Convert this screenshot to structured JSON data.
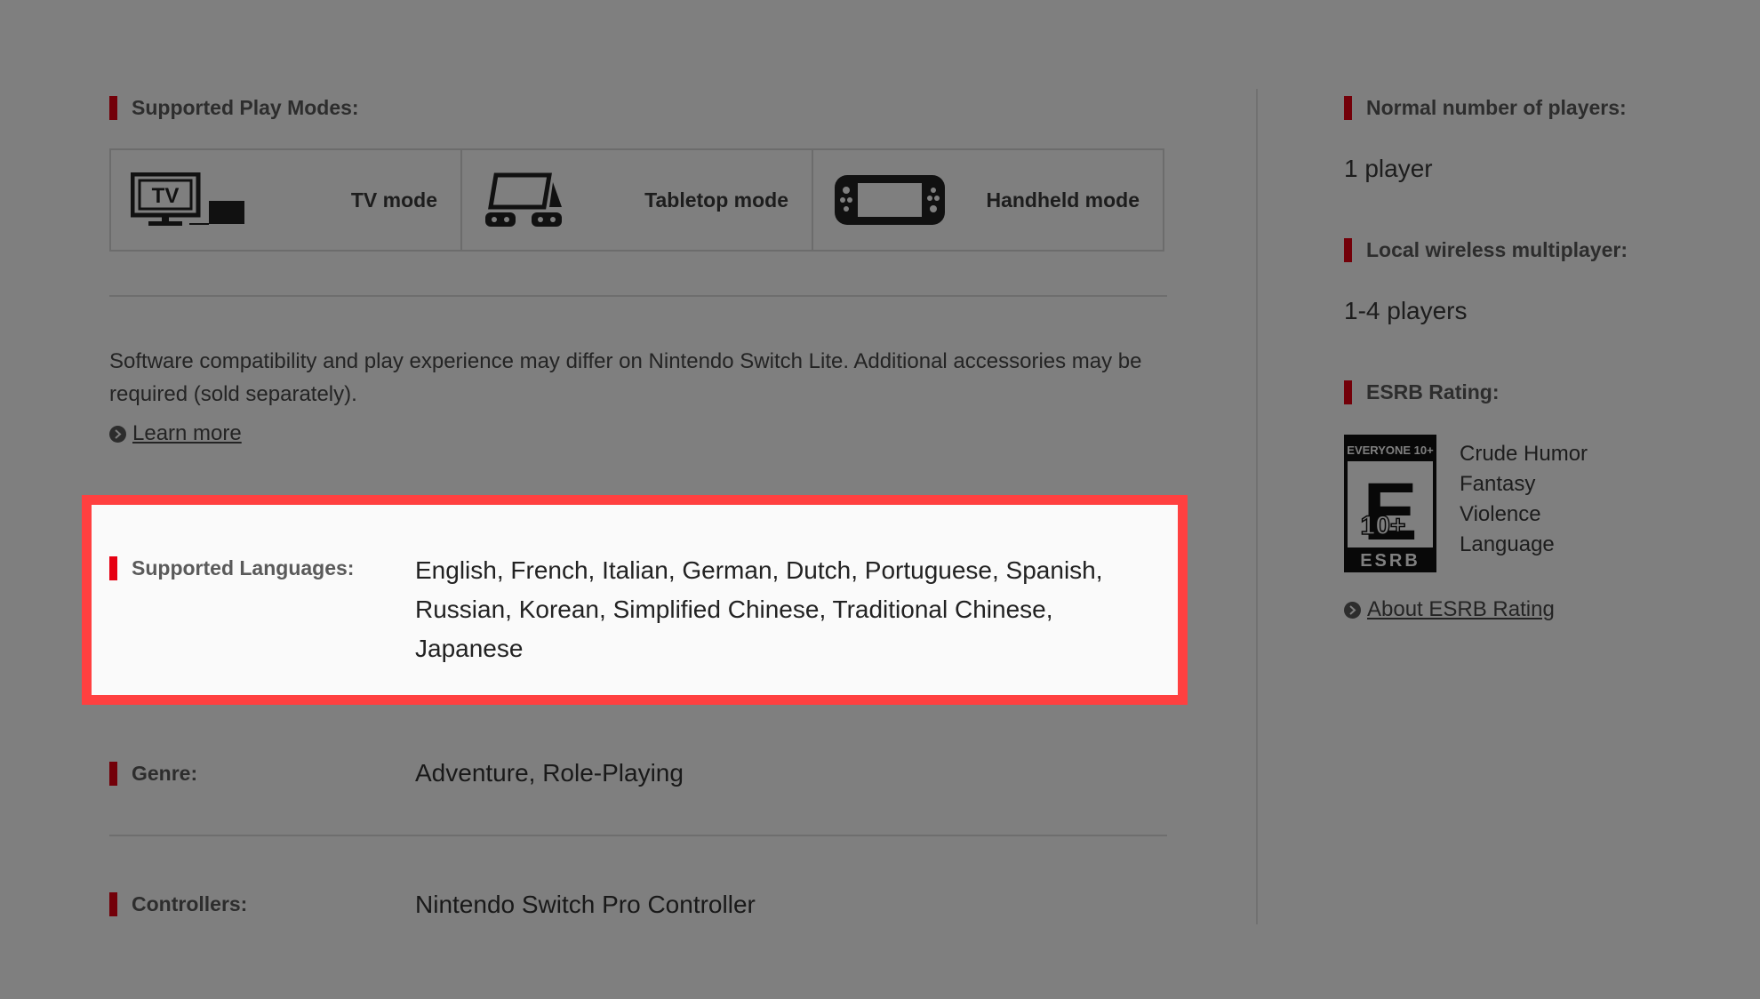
{
  "play_modes": {
    "title": "Supported Play Modes:",
    "modes": [
      {
        "label": "TV mode",
        "icon": "tv-mode-icon"
      },
      {
        "label": "Tabletop mode",
        "icon": "tabletop-mode-icon"
      },
      {
        "label": "Handheld mode",
        "icon": "handheld-mode-icon"
      }
    ],
    "tv_icon_text": "TV"
  },
  "notice": {
    "text": "Software compatibility and play experience may differ on Nintendo Switch Lite. Additional accessories may be required (sold separately).",
    "link": "Learn more"
  },
  "languages": {
    "label": "Supported Languages:",
    "value": "English, French, Italian, German, Dutch, Portuguese, Spanish, Russian, Korean, Simplified Chinese, Traditional Chinese, Japanese"
  },
  "genre": {
    "label": "Genre:",
    "value": "Adventure, Role-Playing"
  },
  "controllers": {
    "label": "Controllers:",
    "value": "Nintendo Switch Pro Controller"
  },
  "players": {
    "normal_label": "Normal number of players:",
    "normal_value": "1 player",
    "wireless_label": "Local wireless multiplayer:",
    "wireless_value": "1-4 players"
  },
  "esrb": {
    "label": "ESRB Rating:",
    "badge_top": "EVERYONE 10+",
    "badge_bottom": "ESRB",
    "badge_letter": "E",
    "badge_age": "10+",
    "descriptors": [
      "Crude Humor",
      "Fantasy",
      "Violence",
      "Language"
    ],
    "link": "About ESRB Rating"
  },
  "colors": {
    "accent": "#e60012",
    "highlight_border": "#ff4040",
    "overlay": "rgba(0,0,0,0.5)"
  }
}
